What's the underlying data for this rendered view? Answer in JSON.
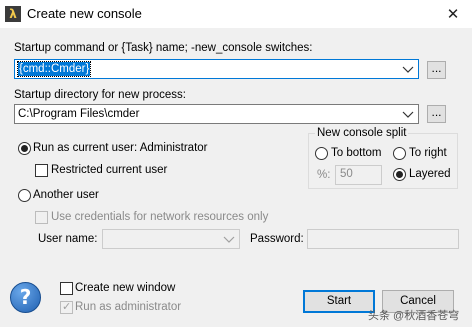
{
  "window": {
    "title": "Create new console",
    "app_icon_glyph": "λ",
    "close_glyph": "✕"
  },
  "startup_command": {
    "label": "Startup command or {Task} name; -new_console switches:",
    "value": "{cmd::Cmder}",
    "browse_label": "..."
  },
  "startup_directory": {
    "label": "Startup directory for new process:",
    "value": "C:\\Program Files\\cmder",
    "browse_label": "..."
  },
  "run_as_current": {
    "label": "Run as current user: Administrator",
    "selected": true
  },
  "restricted_user": {
    "label": "Restricted current user",
    "checked": false
  },
  "split": {
    "group_label": "New console split",
    "to_bottom_label": "To bottom",
    "to_right_label": "To right",
    "percent_label": "%:",
    "percent_value": "50",
    "layered_label": "Layered",
    "selected": "Layered"
  },
  "another_user": {
    "label": "Another user",
    "selected": false,
    "use_credentials_label": "Use credentials for network resources only",
    "username_label": "User name:",
    "password_label": "Password:"
  },
  "create_new_window": {
    "label": "Create new window",
    "checked": false
  },
  "run_as_admin": {
    "label": "Run as administrator",
    "checked": true,
    "enabled": false
  },
  "buttons": {
    "help_glyph": "?",
    "start": "Start",
    "cancel": "Cancel"
  },
  "watermark": "头条 @秋酒香苍穹",
  "colors": {
    "accent": "#0078d7",
    "background": "#f0f0f0"
  }
}
